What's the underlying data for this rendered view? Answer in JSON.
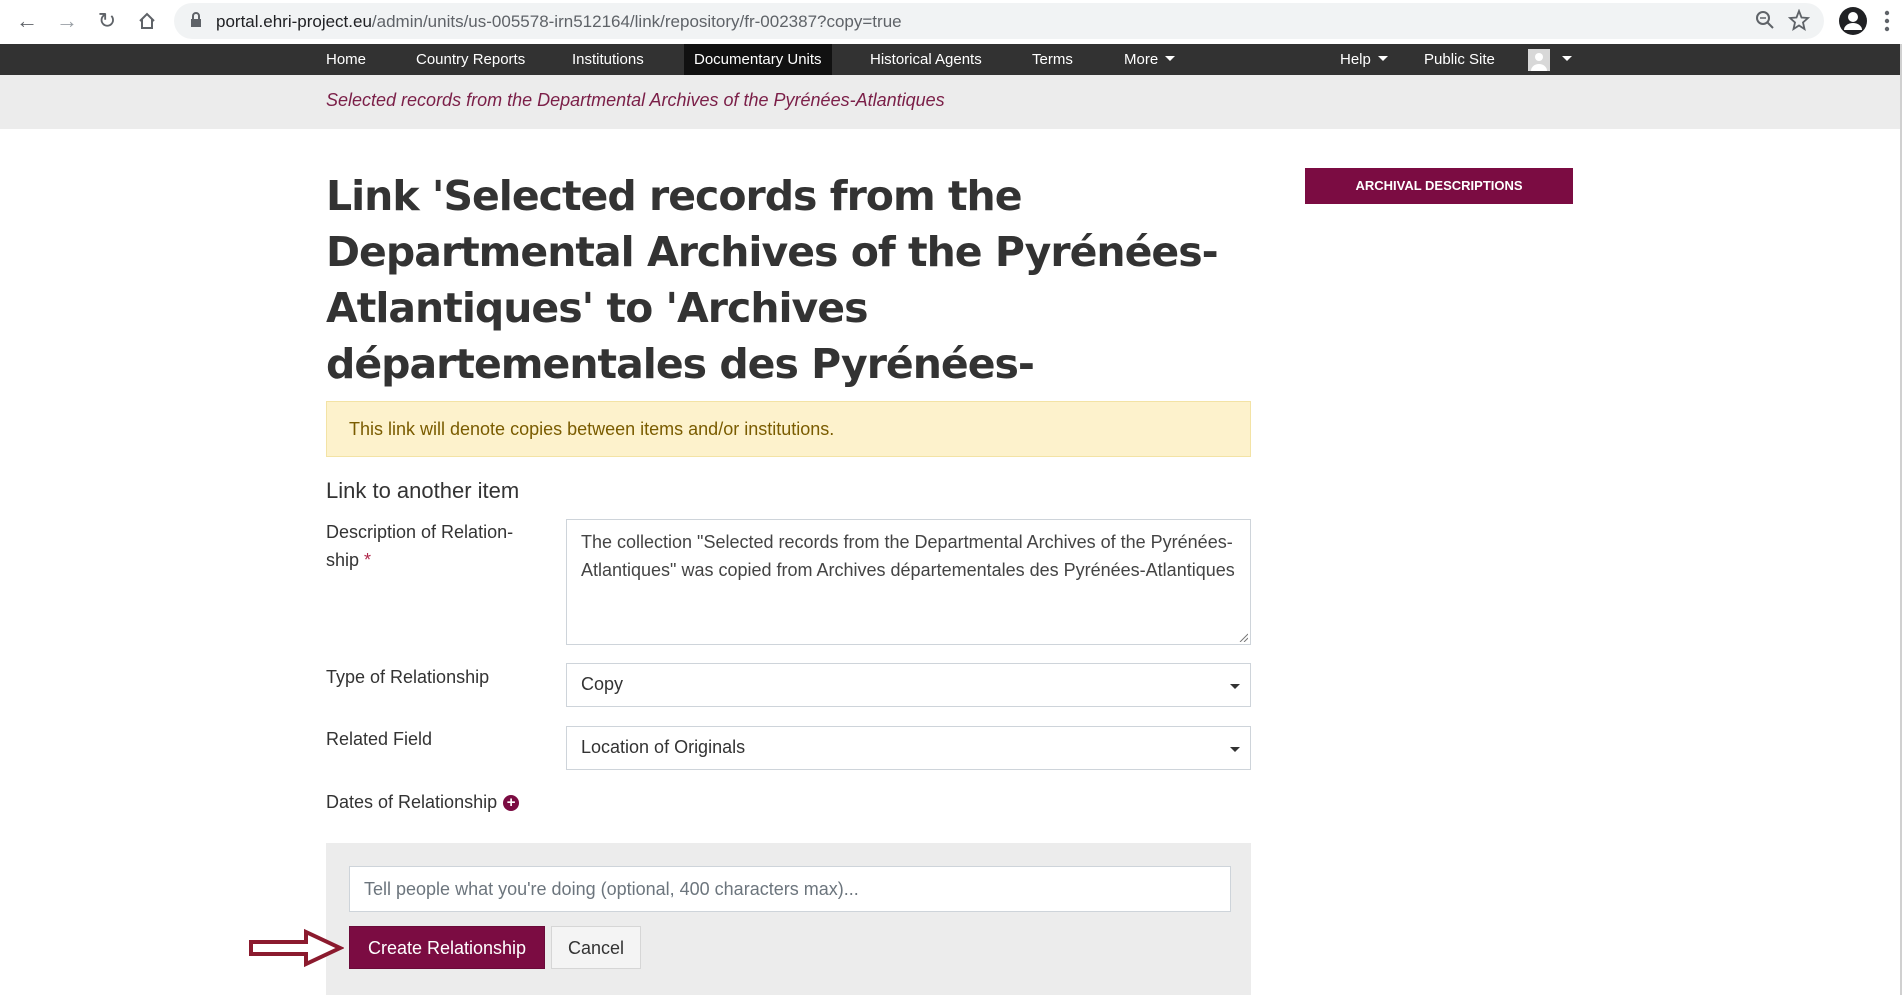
{
  "browser": {
    "url_domain": "portal.ehri-project.eu",
    "url_path": "/admin/units/us-005578-irn512164/link/repository/fr-002387?copy=true"
  },
  "nav": {
    "items": [
      "Home",
      "Country Reports",
      "Institutions",
      "Documentary Units",
      "Historical Agents",
      "Terms",
      "More"
    ],
    "active": "Documentary Units",
    "right_items": [
      "Help",
      "Public Site"
    ]
  },
  "breadcrumb": "Selected records from the Departmental Archives of the Pyrénées-Atlantiques",
  "page": {
    "title": "Link 'Selected records from the Departmental Archives of the Pyrénées-Atlantiques' to 'Archives départementales des Pyrénées-Atlantiques'",
    "sidebar_button": "ARCHIVAL DESCRIPTIONS",
    "alert": "This link will denote copies between items and/or institutions.",
    "section_title": "Link to another item"
  },
  "form": {
    "description_label": "Description of Relation-ship",
    "required_mark": "*",
    "description_value": "The collection \"Selected records from the Departmental Archives of the Pyrénées-Atlantiques\" was copied from Archives départementales des Pyrénées-Atlantiques",
    "type_label": "Type of Relationship",
    "type_value": "Copy",
    "field_label": "Related Field",
    "field_value": "Location of Originals",
    "dates_label": "Dates of Relationship",
    "log_placeholder": "Tell people what you're doing (optional, 400 characters max)...",
    "submit_label": "Create Relationship",
    "cancel_label": "Cancel"
  },
  "colors": {
    "brand": "#7b0c42",
    "navbar": "#323232",
    "alert_bg": "#fdf2cc",
    "annotation_arrow": "#8b1a2e"
  },
  "icons": [
    "back-arrow-icon",
    "forward-arrow-icon",
    "reload-icon",
    "home-icon",
    "lock-icon",
    "zoom-icon",
    "star-icon",
    "profile-icon",
    "menu-kebab-icon",
    "plus-circle-icon",
    "callout-arrow-icon"
  ]
}
